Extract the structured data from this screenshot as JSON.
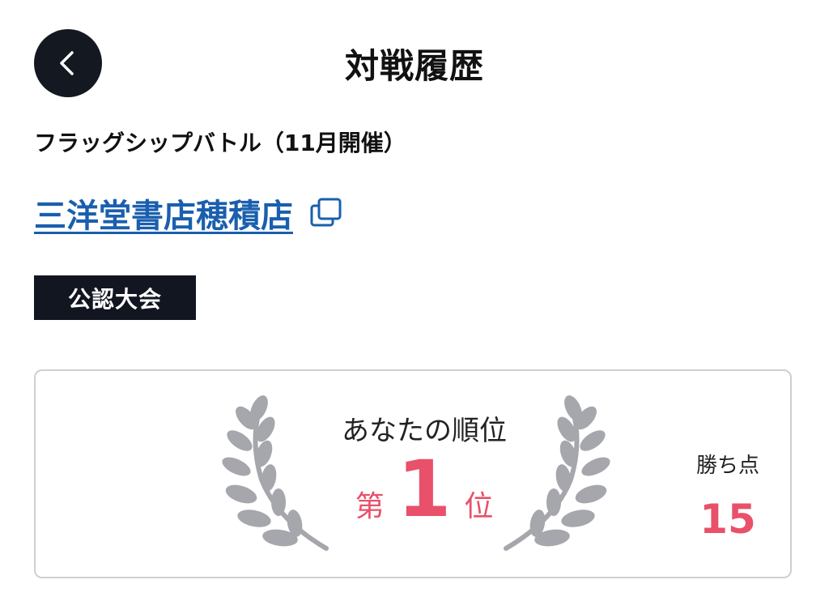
{
  "header": {
    "title": "対戦履歴",
    "back_icon": "chevron-left-icon"
  },
  "event": {
    "name": "フラッグシップバトル（11月開催）"
  },
  "store": {
    "name": "三洋堂書店穂積店",
    "link_color": "#1a5fae",
    "external_icon": "external-link-icon"
  },
  "badge": {
    "label": "公認大会"
  },
  "result": {
    "rank_label": "あなたの順位",
    "rank_prefix": "第",
    "rank_number": "1",
    "rank_suffix": "位",
    "points_label": "勝ち点",
    "points_value": "15",
    "accent_color": "#e9506a",
    "laurel_icon": "laurel-wreath-icon"
  }
}
